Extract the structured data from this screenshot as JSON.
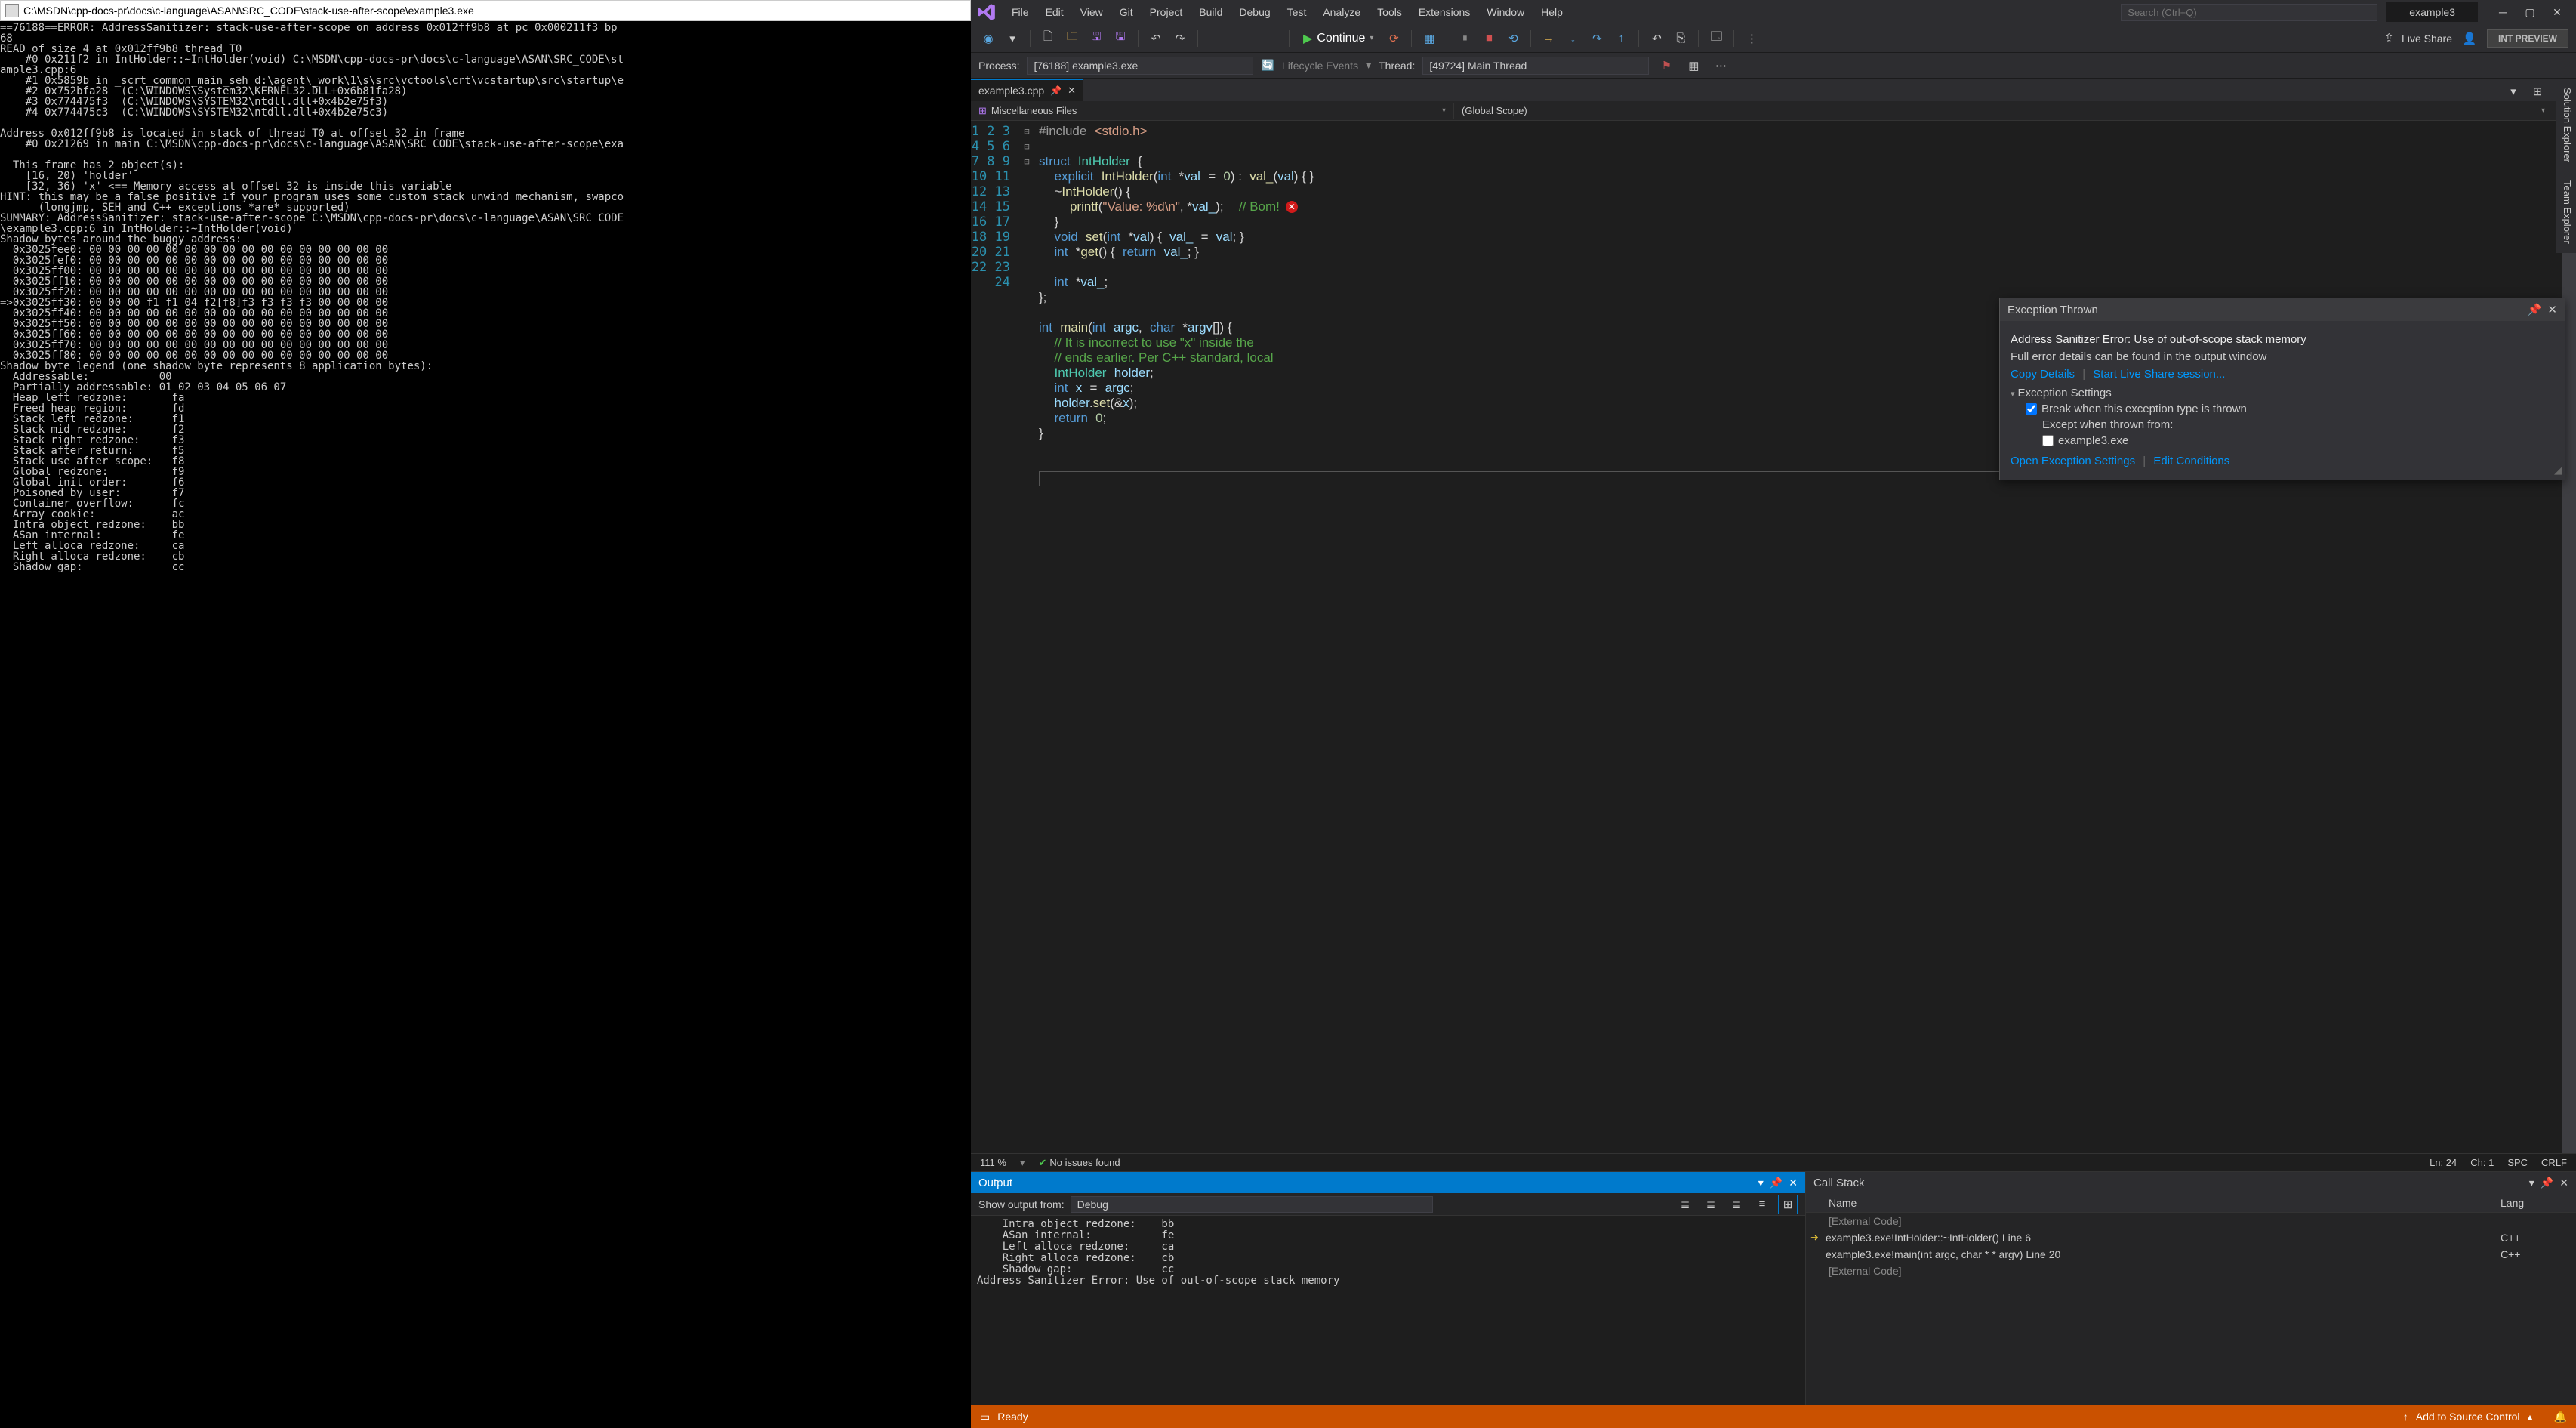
{
  "console": {
    "title": "C:\\MSDN\\cpp-docs-pr\\docs\\c-language\\ASAN\\SRC_CODE\\stack-use-after-scope\\example3.exe",
    "body": "==76188==ERROR: AddressSanitizer: stack-use-after-scope on address 0x012ff9b8 at pc 0x000211f3 bp\n68\nREAD of size 4 at 0x012ff9b8 thread T0\n    #0 0x211f2 in IntHolder::~IntHolder(void) C:\\MSDN\\cpp-docs-pr\\docs\\c-language\\ASAN\\SRC_CODE\\st\nample3.cpp:6\n    #1 0x5859b in _scrt_common_main_seh d:\\agent\\_work\\1\\s\\src\\vctools\\crt\\vcstartup\\src\\startup\\e\n    #2 0x752bfa28  (C:\\WINDOWS\\System32\\KERNEL32.DLL+0x6b81fa28)\n    #3 0x774475f3  (C:\\WINDOWS\\SYSTEM32\\ntdll.dll+0x4b2e75f3)\n    #4 0x774475c3  (C:\\WINDOWS\\SYSTEM32\\ntdll.dll+0x4b2e75c3)\n\nAddress 0x012ff9b8 is located in stack of thread T0 at offset 32 in frame\n    #0 0x21269 in main C:\\MSDN\\cpp-docs-pr\\docs\\c-language\\ASAN\\SRC_CODE\\stack-use-after-scope\\exa\n\n  This frame has 2 object(s):\n    [16, 20) 'holder'\n    [32, 36) 'x' <== Memory access at offset 32 is inside this variable\nHINT: this may be a false positive if your program uses some custom stack unwind mechanism, swapco\n      (longjmp, SEH and C++ exceptions *are* supported)\nSUMMARY: AddressSanitizer: stack-use-after-scope C:\\MSDN\\cpp-docs-pr\\docs\\c-language\\ASAN\\SRC_CODE\n\\example3.cpp:6 in IntHolder::~IntHolder(void)\nShadow bytes around the buggy address:\n  0x3025fee0: 00 00 00 00 00 00 00 00 00 00 00 00 00 00 00 00\n  0x3025fef0: 00 00 00 00 00 00 00 00 00 00 00 00 00 00 00 00\n  0x3025ff00: 00 00 00 00 00 00 00 00 00 00 00 00 00 00 00 00\n  0x3025ff10: 00 00 00 00 00 00 00 00 00 00 00 00 00 00 00 00\n  0x3025ff20: 00 00 00 00 00 00 00 00 00 00 00 00 00 00 00 00\n=>0x3025ff30: 00 00 00 f1 f1 04 f2[f8]f3 f3 f3 f3 00 00 00 00\n  0x3025ff40: 00 00 00 00 00 00 00 00 00 00 00 00 00 00 00 00\n  0x3025ff50: 00 00 00 00 00 00 00 00 00 00 00 00 00 00 00 00\n  0x3025ff60: 00 00 00 00 00 00 00 00 00 00 00 00 00 00 00 00\n  0x3025ff70: 00 00 00 00 00 00 00 00 00 00 00 00 00 00 00 00\n  0x3025ff80: 00 00 00 00 00 00 00 00 00 00 00 00 00 00 00 00\nShadow byte legend (one shadow byte represents 8 application bytes):\n  Addressable:           00\n  Partially addressable: 01 02 03 04 05 06 07\n  Heap left redzone:       fa\n  Freed heap region:       fd\n  Stack left redzone:      f1\n  Stack mid redzone:       f2\n  Stack right redzone:     f3\n  Stack after return:      f5\n  Stack use after scope:   f8\n  Global redzone:          f9\n  Global init order:       f6\n  Poisoned by user:        f7\n  Container overflow:      fc\n  Array cookie:            ac\n  Intra object redzone:    bb\n  ASan internal:           fe\n  Left alloca redzone:     ca\n  Right alloca redzone:    cb\n  Shadow gap:              cc"
  },
  "vs": {
    "menu": [
      "File",
      "Edit",
      "View",
      "Git",
      "Project",
      "Build",
      "Debug",
      "Test",
      "Analyze",
      "Tools",
      "Extensions",
      "Window",
      "Help"
    ],
    "search_placeholder": "Search (Ctrl+Q)",
    "title_tab": "example3",
    "continue_label": "Continue",
    "live_share": "Live Share",
    "int_preview": "INT PREVIEW",
    "process_label": "Process:",
    "process_value": "[76188] example3.exe",
    "lifecycle": "Lifecycle Events",
    "thread_label": "Thread:",
    "thread_value": "[49724] Main Thread",
    "editor_tab": "example3.cpp",
    "nav1": "Miscellaneous Files",
    "nav2": "(Global Scope)",
    "status": {
      "zoom": "111 %",
      "issues": "No issues found",
      "ln": "Ln: 24",
      "ch": "Ch: 1",
      "spc": "SPC",
      "crlf": "CRLF"
    },
    "exception": {
      "title": "Exception Thrown",
      "message": "Address Sanitizer Error: Use of out-of-scope stack memory",
      "details": "Full error details can be found in the output window",
      "copy": "Copy Details",
      "liveshare": "Start Live Share session...",
      "settings_label": "Exception Settings",
      "break_label": "Break when this exception type is thrown",
      "except_label": "Except when thrown from:",
      "except_item": "example3.exe",
      "open_settings": "Open Exception Settings",
      "edit_cond": "Edit Conditions"
    },
    "output": {
      "title": "Output",
      "show_from": "Show output from:",
      "source": "Debug",
      "body": "    Intra object redzone:    bb\n    ASan internal:           fe\n    Left alloca redzone:     ca\n    Right alloca redzone:    cb\n    Shadow gap:              cc\nAddress Sanitizer Error: Use of out-of-scope stack memory"
    },
    "callstack": {
      "title": "Call Stack",
      "col_name": "Name",
      "col_lang": "Lang",
      "rows": [
        {
          "ext": true,
          "text": "[External Code]",
          "lang": ""
        },
        {
          "ext": false,
          "arrow": true,
          "text": "example3.exe!IntHolder::~IntHolder() Line 6",
          "lang": "C++"
        },
        {
          "ext": false,
          "arrow": false,
          "text": "example3.exe!main(int argc, char * * argv) Line 20",
          "lang": "C++"
        },
        {
          "ext": true,
          "text": "[External Code]",
          "lang": ""
        }
      ]
    },
    "statusbar": {
      "ready": "Ready",
      "source_control": "Add to Source Control"
    },
    "side_tabs": [
      "Solution Explorer",
      "Team Explorer"
    ]
  }
}
